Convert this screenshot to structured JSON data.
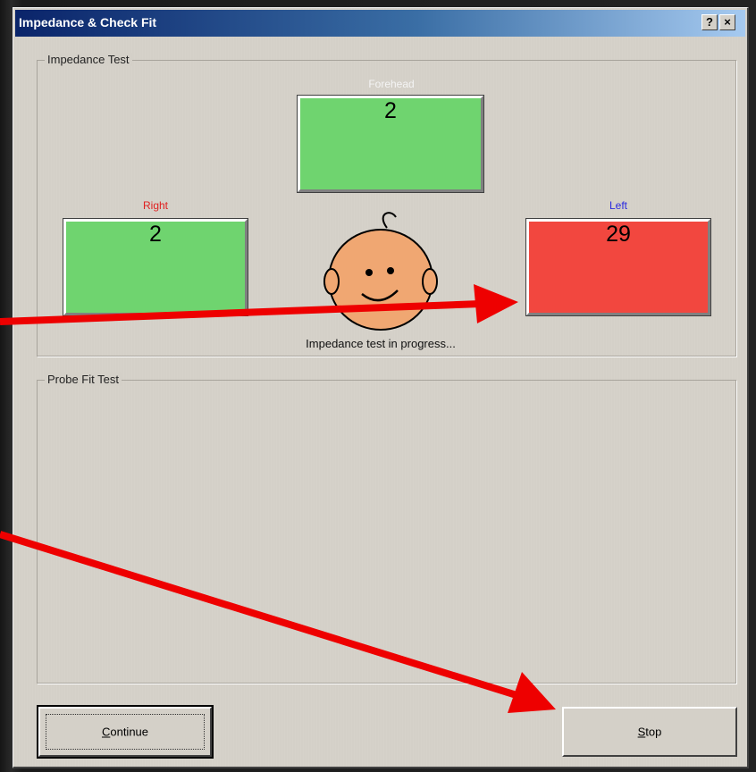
{
  "window": {
    "title": "Impedance & Check Fit",
    "help_button": "?",
    "close_button": "×"
  },
  "impedance_group": {
    "label": "Impedance Test",
    "forehead": {
      "caption": "Forehead",
      "value": "2",
      "caption_color": "#f4f4f4",
      "box_color": "#6fd46f"
    },
    "right": {
      "caption": "Right",
      "value": "2",
      "caption_color": "#e02020",
      "box_color": "#6fd46f"
    },
    "left": {
      "caption": "Left",
      "value": "29",
      "caption_color": "#2a2ae0",
      "box_color": "#f2473f"
    },
    "face_icon": "baby-face-icon",
    "status": "Impedance test in progress..."
  },
  "probe_group": {
    "label": "Probe Fit Test"
  },
  "buttons": {
    "continue": "Continue",
    "stop": "Stop"
  },
  "annotation_color": "#ee0000"
}
